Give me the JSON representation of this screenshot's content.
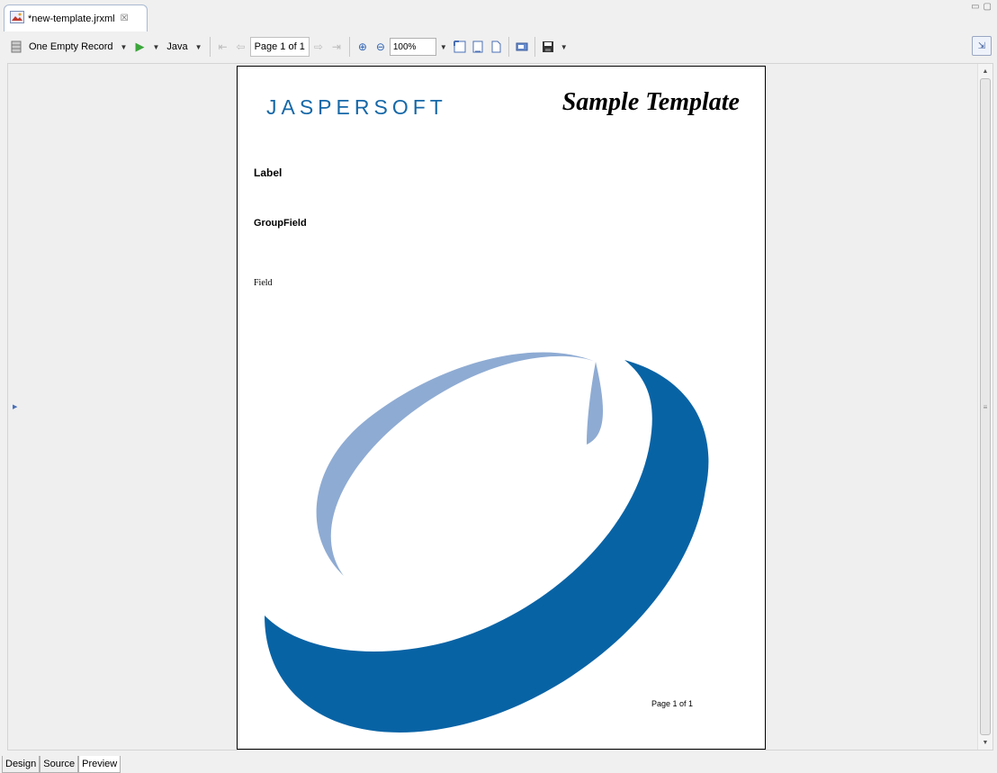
{
  "editor": {
    "tab_title": "*new-template.jrxml",
    "close_glyph": "☒",
    "minimize_glyph": "▭",
    "maximize_glyph": "▢"
  },
  "toolbar": {
    "data_adapter": "One Empty Record",
    "language": "Java",
    "page_indicator": "Page 1 of 1",
    "zoom": "100%",
    "icons": [
      "data-adapter-icon",
      "run-icon",
      "first-page-icon",
      "prev-page-icon",
      "next-page-icon",
      "last-page-icon",
      "zoom-in-icon",
      "zoom-out-icon",
      "fit-page-icon",
      "fit-width-icon",
      "actual-size-icon",
      "export-icon",
      "save-icon",
      "preview-mode-icon"
    ]
  },
  "report": {
    "logo": "JASPERSOFT",
    "title": "Sample Template",
    "label": "Label",
    "group_field": "GroupField",
    "field": "Field",
    "footer": "Page 1 of 1",
    "colors": {
      "logo_blue": "#1668a8",
      "ring_dark": "#0863a5",
      "ring_light": "#8eabd3"
    }
  },
  "bottom_tabs": [
    {
      "label": "Design",
      "active": false
    },
    {
      "label": "Source",
      "active": false
    },
    {
      "label": "Preview",
      "active": true
    }
  ]
}
